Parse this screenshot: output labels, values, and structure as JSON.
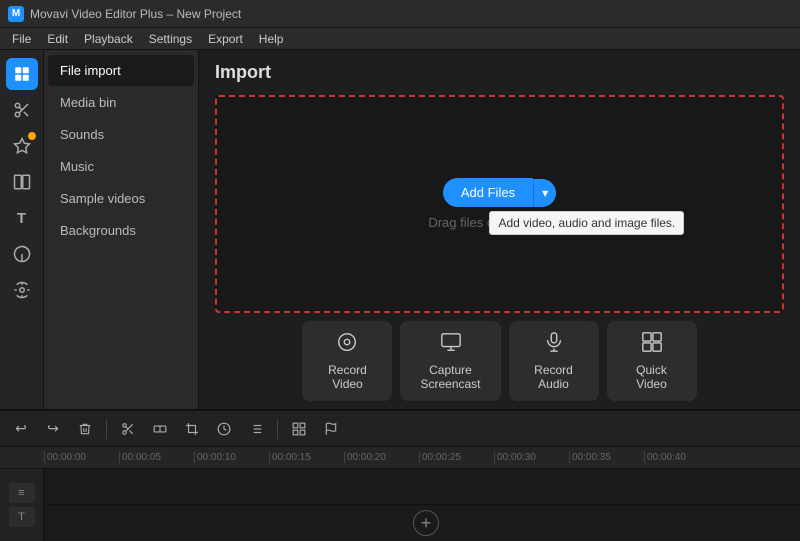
{
  "titleBar": {
    "icon": "M",
    "title": "Movavi Video Editor Plus – New Project"
  },
  "menuBar": {
    "items": [
      "File",
      "Edit",
      "Playback",
      "Settings",
      "Export",
      "Help"
    ]
  },
  "leftToolbar": {
    "buttons": [
      {
        "name": "import-icon",
        "icon": "⬆",
        "active": true,
        "badge": false
      },
      {
        "name": "cut-icon",
        "icon": "✂",
        "active": false,
        "badge": false
      },
      {
        "name": "effect-icon",
        "icon": "★",
        "active": false,
        "badge": true
      },
      {
        "name": "transition-icon",
        "icon": "▣",
        "active": false,
        "badge": false
      },
      {
        "name": "text-icon",
        "icon": "T",
        "active": false,
        "badge": false
      },
      {
        "name": "filter-icon",
        "icon": "◔",
        "active": false,
        "badge": false
      },
      {
        "name": "audio-icon",
        "icon": "🔧",
        "active": false,
        "badge": false
      }
    ]
  },
  "sidebar": {
    "items": [
      {
        "label": "File import",
        "active": true
      },
      {
        "label": "Media bin",
        "active": false
      },
      {
        "label": "Sounds",
        "active": false
      },
      {
        "label": "Music",
        "active": false
      },
      {
        "label": "Sample videos",
        "active": false
      },
      {
        "label": "Backgrounds",
        "active": false
      }
    ]
  },
  "content": {
    "title": "Import",
    "importZone": {
      "dragText": "Drag files or folders here",
      "addFilesLabel": "Add Files",
      "dropdownIcon": "▾",
      "tooltip": "Add video, audio and image files."
    }
  },
  "actionButtons": [
    {
      "name": "record-video-btn",
      "icon": "⊙",
      "label": "Record\nVideo"
    },
    {
      "name": "capture-screencast-btn",
      "icon": "🖥",
      "label": "Capture\nScreencast"
    },
    {
      "name": "record-audio-btn",
      "icon": "🎤",
      "label": "Record\nAudio"
    },
    {
      "name": "quick-video-btn",
      "icon": "▣",
      "label": "Quick\nVideo"
    }
  ],
  "timeline": {
    "tools": [
      "↩",
      "↪",
      "🗑",
      "|",
      "✂",
      "↩",
      "⊡",
      "⏱",
      "≡",
      "|",
      "⊞",
      "⚑"
    ],
    "rulerMarks": [
      "00:00:00",
      "00:00:05",
      "00:00:10",
      "00:00:15",
      "00:00:20",
      "00:00:25",
      "00:00:30",
      "00:00:35",
      "00:00:40"
    ]
  }
}
